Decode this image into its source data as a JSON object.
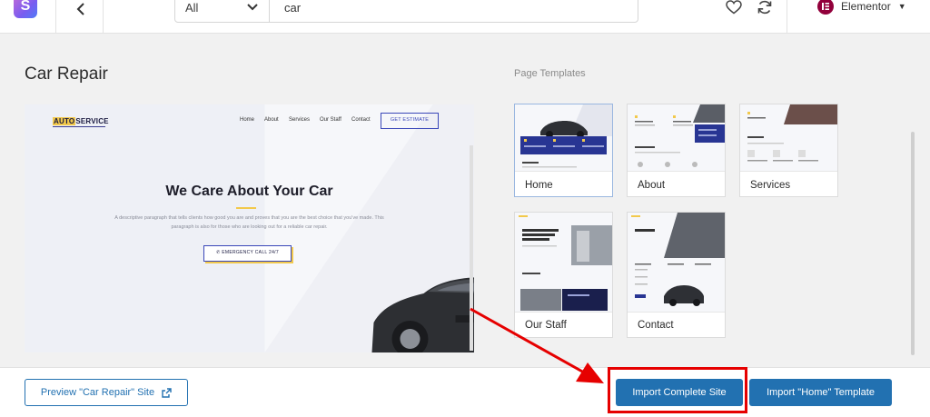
{
  "header": {
    "category_select": "All",
    "search_value": "car",
    "builder_label": "Elementor"
  },
  "site": {
    "title": "Car Repair",
    "section_label": "Page Templates"
  },
  "preview": {
    "brand_a": "AUTO",
    "brand_b": "SERVICE",
    "nav": [
      "Home",
      "About",
      "Services",
      "Our Staff",
      "Contact"
    ],
    "cta": "GET ESTIMATE",
    "hero_title": "We Care About Your Car",
    "hero_text": "A descriptive paragraph that tells clients how good you are and proves that you are the best choice that you've made. This paragraph is also for those who are looking out for a reliable car repair.",
    "call_button": "EMERGENCY CALL 24/7"
  },
  "templates": [
    {
      "label": "Home",
      "selected": true
    },
    {
      "label": "About",
      "selected": false
    },
    {
      "label": "Services",
      "selected": false
    },
    {
      "label": "Our Staff",
      "selected": false
    },
    {
      "label": "Contact",
      "selected": false
    }
  ],
  "footer": {
    "preview_button": "Preview \"Car Repair\" Site",
    "import_site_button": "Import Complete Site",
    "import_template_button": "Import \"Home\" Template"
  },
  "colors": {
    "primary": "#2271b1",
    "highlight": "#e60000",
    "accent_yellow": "#f2c94c",
    "navy": "#3a47b8"
  },
  "icons": [
    "app-logo-icon",
    "back-arrow-icon",
    "chevron-down-icon",
    "heart-icon",
    "refresh-icon",
    "elementor-icon",
    "external-link-icon",
    "phone-icon"
  ]
}
